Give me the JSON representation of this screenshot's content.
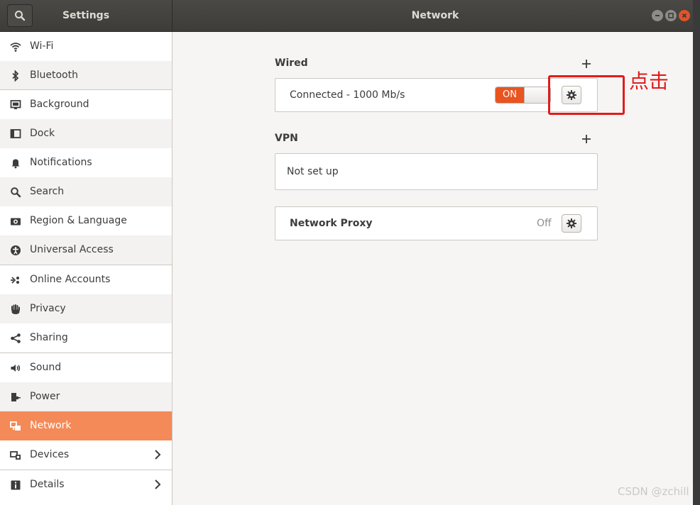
{
  "titlebar": {
    "left_title": "Settings",
    "center_title": "Network"
  },
  "sidebar": {
    "items": [
      {
        "label": "Wi-Fi",
        "icon": "wifi-icon"
      },
      {
        "label": "Bluetooth",
        "icon": "bluetooth-icon"
      },
      {
        "label": "Background",
        "icon": "background-icon"
      },
      {
        "label": "Dock",
        "icon": "dock-icon"
      },
      {
        "label": "Notifications",
        "icon": "bell-icon"
      },
      {
        "label": "Search",
        "icon": "search-icon"
      },
      {
        "label": "Region & Language",
        "icon": "camera-icon"
      },
      {
        "label": "Universal Access",
        "icon": "accessibility-icon"
      },
      {
        "label": "Online Accounts",
        "icon": "online-accounts-icon"
      },
      {
        "label": "Privacy",
        "icon": "hand-icon"
      },
      {
        "label": "Sharing",
        "icon": "share-icon"
      },
      {
        "label": "Sound",
        "icon": "speaker-icon"
      },
      {
        "label": "Power",
        "icon": "power-plug-icon"
      },
      {
        "label": "Network",
        "icon": "network-icon",
        "active": true
      },
      {
        "label": "Devices",
        "icon": "devices-icon",
        "chevron": true
      },
      {
        "label": "Details",
        "icon": "info-icon",
        "chevron": true
      }
    ]
  },
  "main": {
    "wired": {
      "title": "Wired",
      "status": "Connected - 1000 Mb/s",
      "switch_label": "ON"
    },
    "vpn": {
      "title": "VPN",
      "empty_text": "Not set up"
    },
    "proxy": {
      "label": "Network Proxy",
      "state": "Off"
    }
  },
  "annotation": {
    "text": "点击",
    "color": "#e21b1b"
  },
  "watermark": "CSDN @zchill",
  "colors": {
    "accent": "#e95420",
    "active_row": "#f48a57",
    "titlebar": "#3d3c39"
  }
}
